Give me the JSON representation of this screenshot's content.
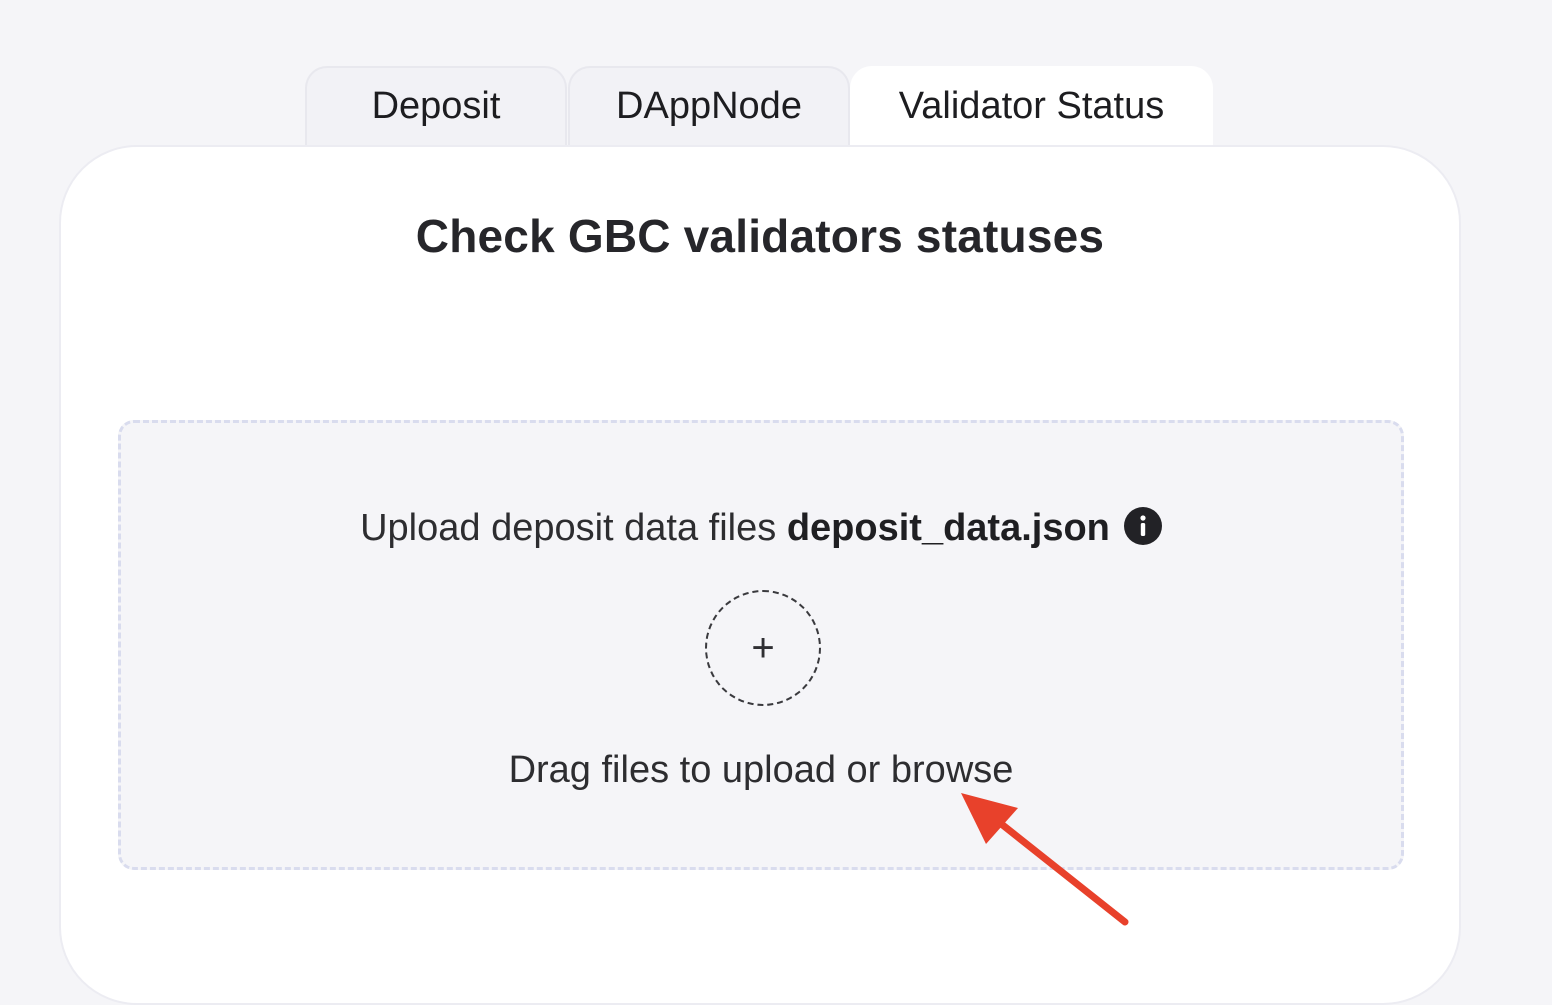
{
  "tabs": [
    {
      "label": "Deposit",
      "active": false
    },
    {
      "label": "DAppNode",
      "active": false
    },
    {
      "label": "Validator Status",
      "active": true
    }
  ],
  "card": {
    "title": "Check GBC validators statuses"
  },
  "dropzone": {
    "upload_text": "Upload deposit data files",
    "file_name": "deposit_data.json",
    "info_icon": "info-icon",
    "add_icon": "plus-icon",
    "plus_glyph": "+",
    "drag_text": "Drag files to upload or browse"
  },
  "annotation": {
    "arrow_color": "#e8412b",
    "arrow_icon": "arrow-icon"
  },
  "colors": {
    "background": "#f5f5f8",
    "card": "#ffffff",
    "dropzone_border": "#d9dcee"
  }
}
